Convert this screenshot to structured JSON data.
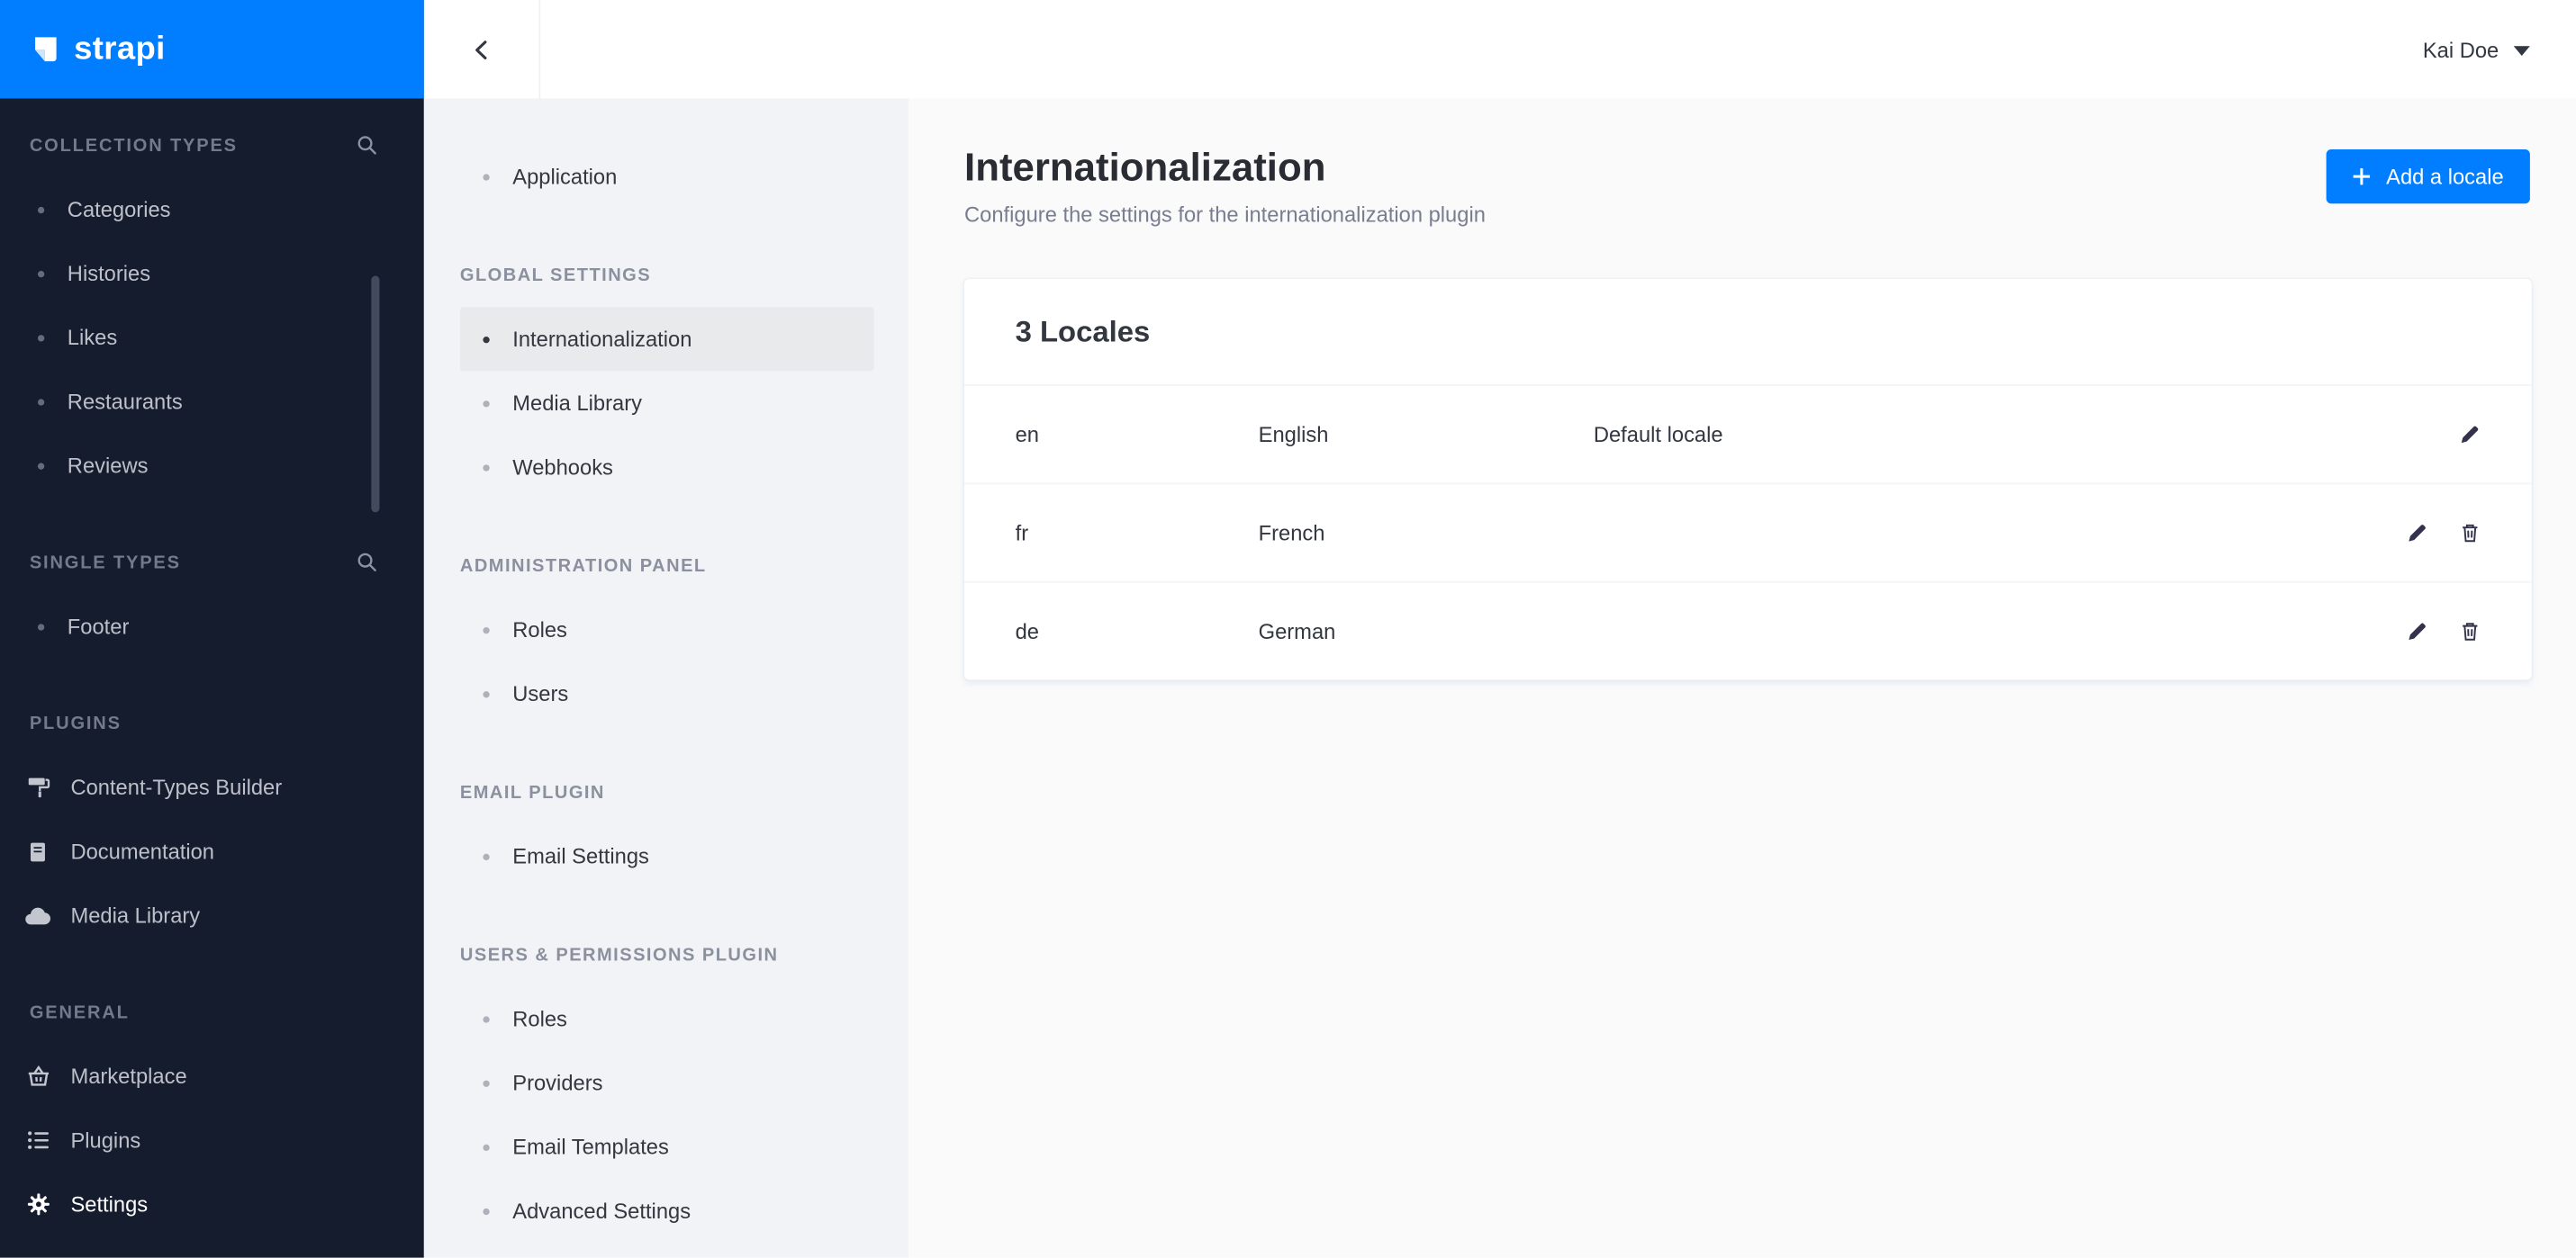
{
  "colors": {
    "accent": "#007eff",
    "sidebar_bg": "#151c2e",
    "subnav_active_bg": "#e9eaec"
  },
  "brand": {
    "name": "strapi"
  },
  "topbar": {
    "user_name": "Kai Doe"
  },
  "sidebar": {
    "sections": [
      {
        "label": "COLLECTION TYPES",
        "items": [
          {
            "label": "Categories"
          },
          {
            "label": "Histories"
          },
          {
            "label": "Likes"
          },
          {
            "label": "Restaurants"
          },
          {
            "label": "Reviews"
          }
        ]
      },
      {
        "label": "SINGLE TYPES",
        "items": [
          {
            "label": "Footer"
          }
        ]
      },
      {
        "label": "PLUGINS",
        "items": [
          {
            "label": "Content-Types Builder"
          },
          {
            "label": "Documentation"
          },
          {
            "label": "Media Library"
          }
        ]
      },
      {
        "label": "GENERAL",
        "items": [
          {
            "label": "Marketplace"
          },
          {
            "label": "Plugins"
          },
          {
            "label": "Settings"
          }
        ]
      }
    ]
  },
  "subnav": {
    "application_item": "Application",
    "sections": [
      {
        "label": "GLOBAL SETTINGS",
        "items": [
          {
            "label": "Internationalization"
          },
          {
            "label": "Media Library"
          },
          {
            "label": "Webhooks"
          }
        ]
      },
      {
        "label": "ADMINISTRATION PANEL",
        "items": [
          {
            "label": "Roles"
          },
          {
            "label": "Users"
          }
        ]
      },
      {
        "label": "EMAIL PLUGIN",
        "items": [
          {
            "label": "Email Settings"
          }
        ]
      },
      {
        "label": "USERS & PERMISSIONS PLUGIN",
        "items": [
          {
            "label": "Roles"
          },
          {
            "label": "Providers"
          },
          {
            "label": "Email Templates"
          },
          {
            "label": "Advanced Settings"
          }
        ]
      }
    ]
  },
  "main": {
    "title": "Internationalization",
    "subtitle": "Configure the settings for the internationalization plugin",
    "add_locale_button": "Add a locale",
    "locales_card": {
      "title": "3 Locales",
      "rows": [
        {
          "code": "en",
          "name": "English",
          "note": "Default locale"
        },
        {
          "code": "fr",
          "name": "French",
          "note": ""
        },
        {
          "code": "de",
          "name": "German",
          "note": ""
        }
      ]
    }
  }
}
